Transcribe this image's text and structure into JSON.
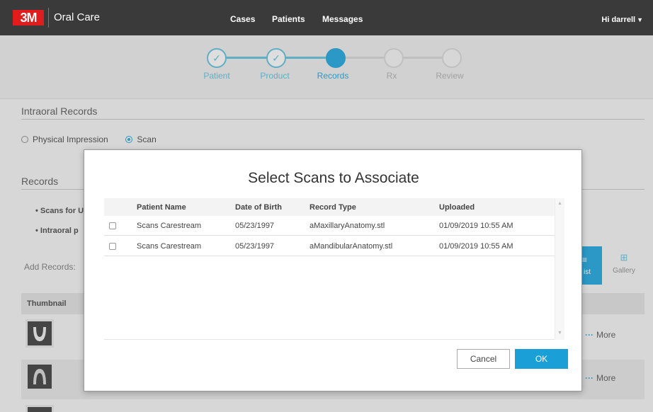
{
  "header": {
    "logo": "3M",
    "brand": "Oral Care",
    "nav": [
      "Cases",
      "Patients",
      "Messages"
    ],
    "greeting": "Hi darrell"
  },
  "stepper": {
    "steps": [
      {
        "label": "Patient",
        "state": "done"
      },
      {
        "label": "Product",
        "state": "done"
      },
      {
        "label": "Records",
        "state": "active"
      },
      {
        "label": "Rx",
        "state": "todo"
      },
      {
        "label": "Review",
        "state": "todo"
      }
    ],
    "check_glyph": "✓"
  },
  "intraoral": {
    "title": "Intraoral Records",
    "option_physical": "Physical Impression",
    "option_scan": "Scan",
    "selected": "Scan"
  },
  "records": {
    "title": "Records",
    "bullets": [
      "Scans for U",
      "Intraoral p"
    ],
    "add_label": "Add Records:",
    "view_list": "ist",
    "view_gallery": "Gallery",
    "thumbnail_header": "Thumbnail",
    "more_label": "More"
  },
  "modal": {
    "title": "Select Scans to Associate",
    "columns": [
      "Patient Name",
      "Date of Birth",
      "Record Type",
      "Uploaded"
    ],
    "rows": [
      {
        "patient": "Scans Carestream",
        "dob": "05/23/1997",
        "type": "aMaxillaryAnatomy.stl",
        "uploaded": "01/09/2019 10:55 AM",
        "checked": false
      },
      {
        "patient": "Scans Carestream",
        "dob": "05/23/1997",
        "type": "aMandibularAnatomy.stl",
        "uploaded": "01/09/2019 10:55 AM",
        "checked": false
      }
    ],
    "cancel_label": "Cancel",
    "ok_label": "OK"
  },
  "colors": {
    "accent": "#1a9fd6",
    "nav_bg": "#3a3a3a",
    "logo_red": "#e01d1d"
  }
}
